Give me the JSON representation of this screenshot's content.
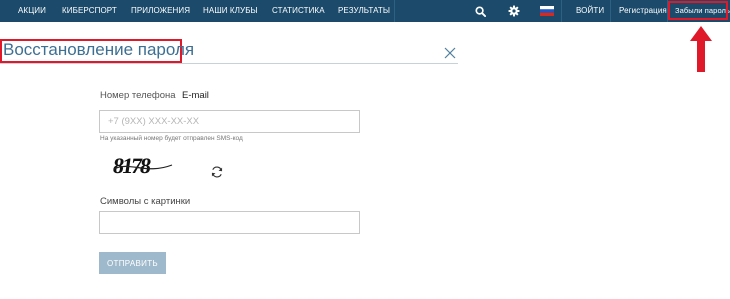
{
  "nav": {
    "items": [
      "АКЦИИ",
      "КИБЕРСПОРТ",
      "ПРИЛОЖЕНИЯ",
      "НАШИ КЛУБЫ",
      "СТАТИСТИКА",
      "РЕЗУЛЬТАТЫ"
    ],
    "login": "ВОЙТИ",
    "register": "Регистрация",
    "forgot": "Забыли пароль",
    "icons": [
      "search-icon",
      "settings-gear-icon",
      "russian-flag-icon"
    ]
  },
  "page": {
    "title": "Восстановление пароля"
  },
  "form": {
    "tabs": [
      "Номер телефона",
      "E-mail"
    ],
    "phone_placeholder": "+7 (9XX) XXX-XX-XX",
    "phone_value": "",
    "hint": "На указанный номер будет отправлен SMS-код",
    "captcha_text": "8178",
    "captcha_label": "Символы с картинки",
    "captcha_value": "",
    "submit": "ОТПРАВИТЬ"
  },
  "colors": {
    "navbar": "#1b4a6b",
    "title": "#3d6f93",
    "annotation": "#e0192a",
    "button": "#9fb9cc"
  }
}
